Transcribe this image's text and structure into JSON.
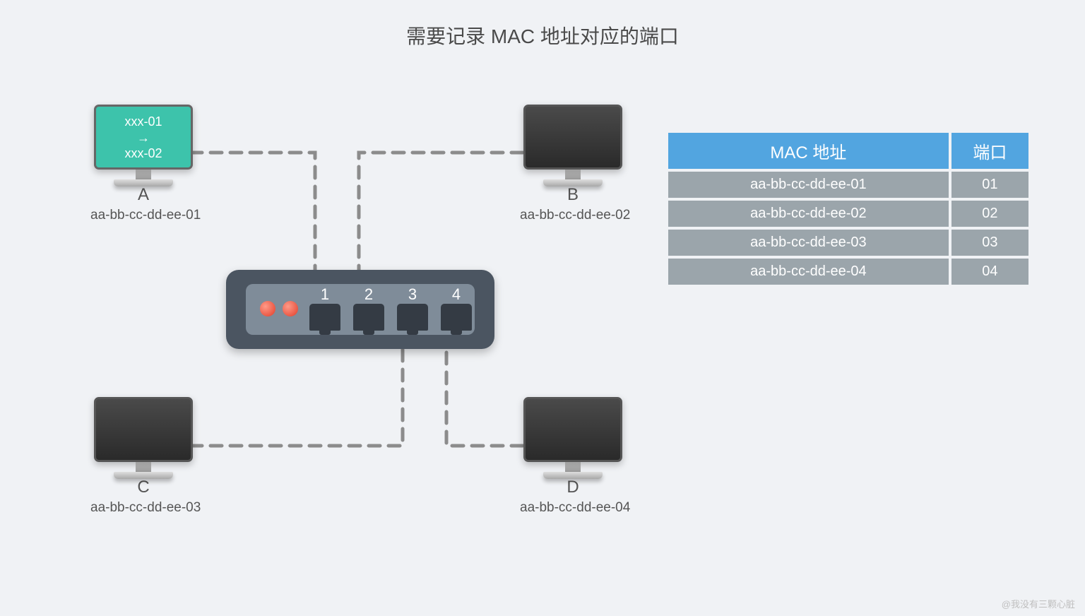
{
  "title": "需要记录 MAC 地址对应的端口",
  "watermark": "@我没有三颗心脏",
  "screen_msg": {
    "line1": "xxx-01",
    "arrow": "→",
    "line2": "xxx-02"
  },
  "nodes": {
    "a": {
      "label": "A",
      "mac": "aa-bb-cc-dd-ee-01"
    },
    "b": {
      "label": "B",
      "mac": "aa-bb-cc-dd-ee-02"
    },
    "c": {
      "label": "C",
      "mac": "aa-bb-cc-dd-ee-03"
    },
    "d": {
      "label": "D",
      "mac": "aa-bb-cc-dd-ee-04"
    }
  },
  "switch_ports": {
    "p1": "1",
    "p2": "2",
    "p3": "3",
    "p4": "4"
  },
  "table": {
    "headers": {
      "mac": "MAC 地址",
      "port": "端口"
    },
    "rows": [
      {
        "mac": "aa-bb-cc-dd-ee-01",
        "port": "01"
      },
      {
        "mac": "aa-bb-cc-dd-ee-02",
        "port": "02"
      },
      {
        "mac": "aa-bb-cc-dd-ee-03",
        "port": "03"
      },
      {
        "mac": "aa-bb-cc-dd-ee-04",
        "port": "04"
      }
    ]
  }
}
